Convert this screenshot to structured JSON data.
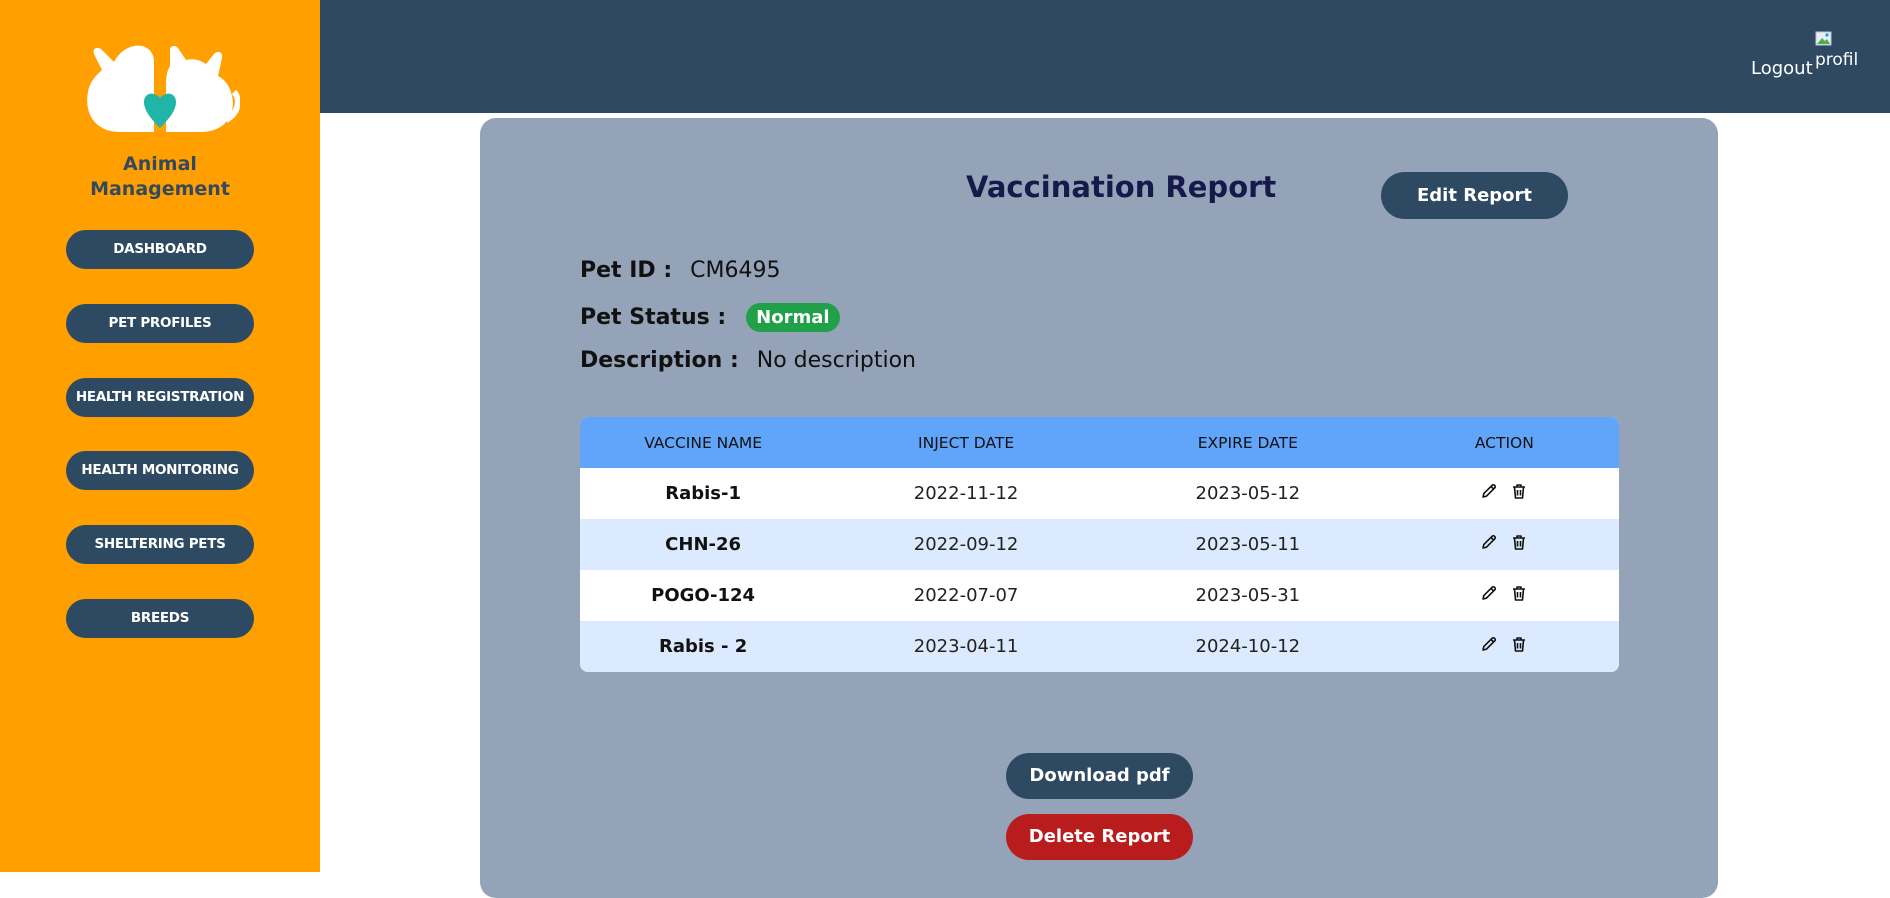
{
  "sidebar": {
    "brand_line1": "Animal",
    "brand_line2": "Management",
    "logo_icon": "cat-dog-heart-logo",
    "items": [
      {
        "label": "DASHBOARD"
      },
      {
        "label": "PET PROFILES"
      },
      {
        "label": "HEALTH REGISTRATION"
      },
      {
        "label": "HEALTH MONITORING"
      },
      {
        "label": "SHELTERING PETS"
      },
      {
        "label": "BREEDS"
      }
    ]
  },
  "header": {
    "logout_label": "Logout",
    "profile_alt": "profil"
  },
  "report": {
    "title": "Vaccination Report",
    "edit_label": "Edit Report",
    "pet_id_label": "Pet ID :",
    "pet_id_value": "CM6495",
    "pet_status_label": "Pet Status :",
    "pet_status_value": "Normal",
    "description_label": "Description :",
    "description_value": "No description"
  },
  "table": {
    "headers": [
      "VACCINE NAME",
      "INJECT DATE",
      "EXPIRE DATE",
      "ACTION"
    ],
    "rows": [
      {
        "name": "Rabis-1",
        "inject": "2022-11-12",
        "expire": "2023-05-12"
      },
      {
        "name": "CHN-26",
        "inject": "2022-09-12",
        "expire": "2023-05-11"
      },
      {
        "name": "POGO-124",
        "inject": "2022-07-07",
        "expire": "2023-05-31"
      },
      {
        "name": "Rabis - 2",
        "inject": "2023-04-11",
        "expire": "2024-10-12"
      }
    ],
    "action_icons": [
      "pencil-icon",
      "trash-icon"
    ]
  },
  "actions": {
    "download_label": "Download pdf",
    "delete_label": "Delete Report"
  },
  "colors": {
    "sidebar": "#ff9f00",
    "topbar": "#2f4962",
    "card": "#94a3b8",
    "button_dark": "#2e4a63",
    "table_header": "#60a5fa",
    "row_alt": "#dbeafe",
    "status_green": "#1fa049",
    "delete_red": "#b91c1c"
  }
}
